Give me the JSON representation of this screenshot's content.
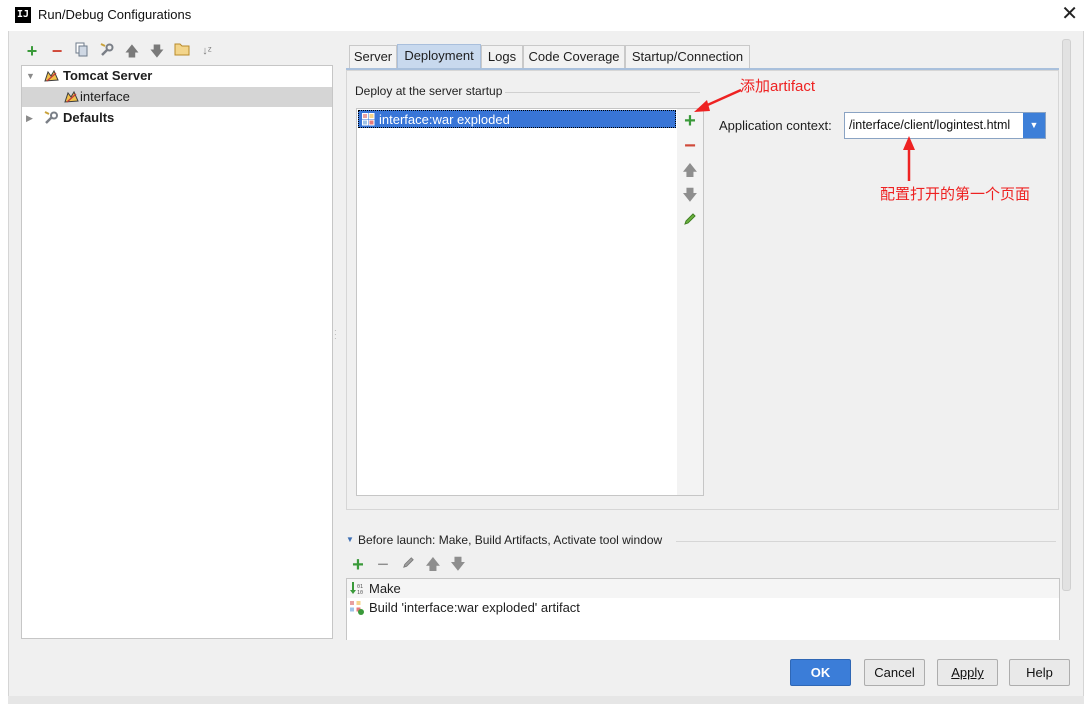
{
  "window": {
    "title": "Run/Debug Configurations",
    "app_icon": "IJ"
  },
  "left_toolbar": [
    "add",
    "remove",
    "copy",
    "edit-defaults",
    "move-up",
    "move-down",
    "folder",
    "sort"
  ],
  "tree": {
    "tomcat_server": "Tomcat Server",
    "interface": "interface",
    "defaults": "Defaults"
  },
  "tabs": [
    "Server",
    "Deployment",
    "Logs",
    "Code Coverage",
    "Startup/Connection"
  ],
  "active_tab": "Deployment",
  "deploy": {
    "section_label": "Deploy at the server startup",
    "artifact": "interface:war exploded",
    "context_label": "Application context:",
    "context_value": "/interface/client/logintest.html"
  },
  "annotations": {
    "add_artifact": "添加artifact",
    "first_page": "配置打开的第一个页面"
  },
  "before_launch": {
    "header": "Before launch: Make, Build Artifacts, Activate tool window",
    "items": [
      "Make",
      "Build 'interface:war exploded' artifact"
    ]
  },
  "buttons": {
    "ok": "OK",
    "cancel": "Cancel",
    "apply": "Apply",
    "help": "Help"
  },
  "colors": {
    "accent": "#3b7dd8",
    "annotation": "#ee2222",
    "selection": "#3875d7"
  }
}
